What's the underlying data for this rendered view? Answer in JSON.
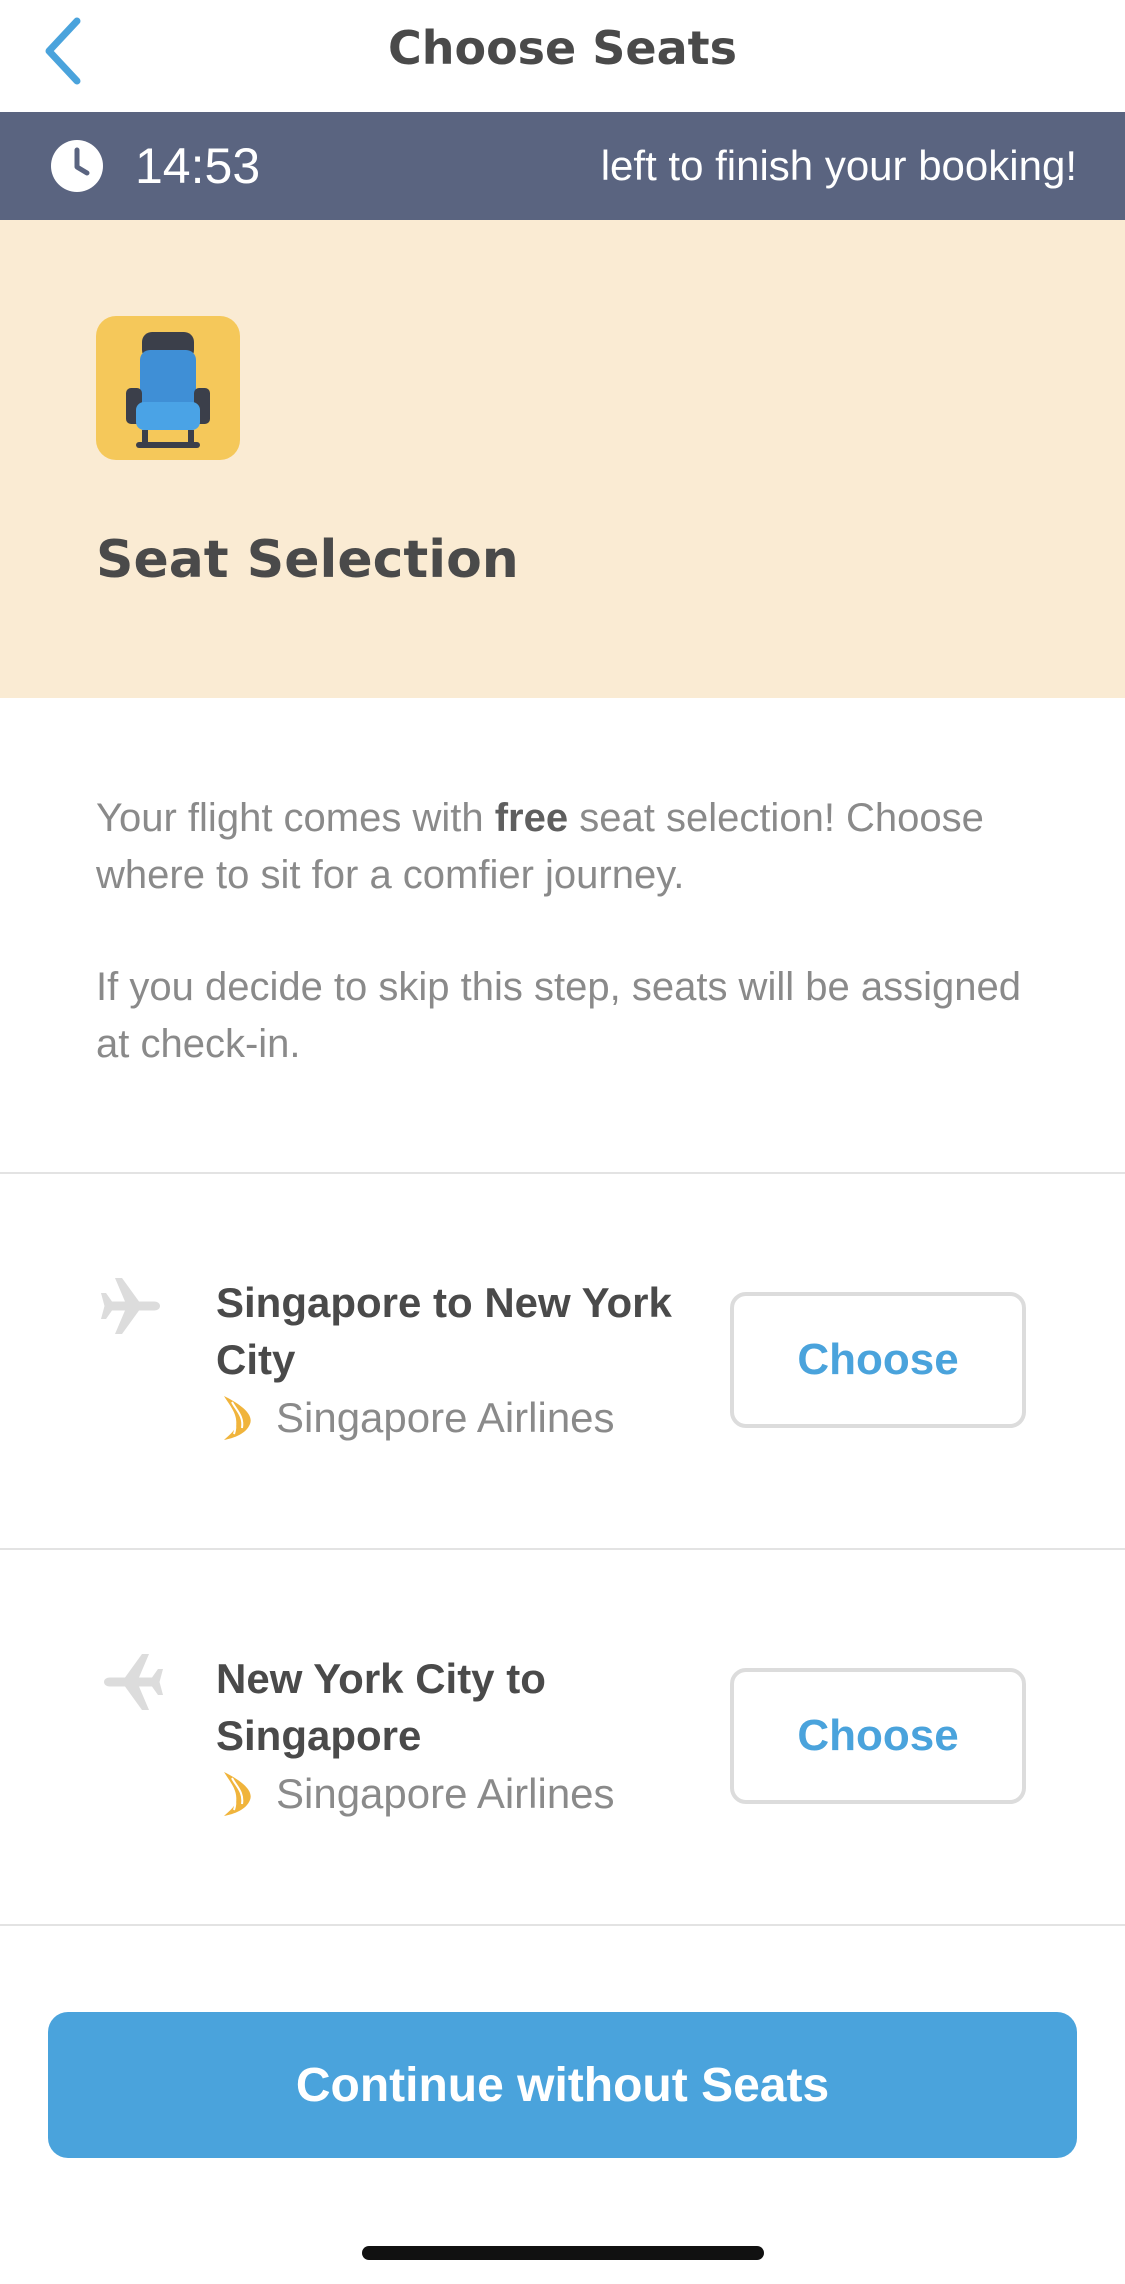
{
  "header": {
    "title": "Choose Seats",
    "back_icon": "chevron-left-icon",
    "accent_color": "#4aa3dc"
  },
  "timer": {
    "time": "14:53",
    "message": "left to finish your booking!",
    "background": "#5a6480"
  },
  "banner": {
    "title": "Seat Selection",
    "icon": "seat-icon",
    "background": "#faebd3"
  },
  "description": {
    "line1_before": "Your flight comes with ",
    "line1_bold": "free",
    "line1_after": " seat selection! Choose where to sit for a comfier journey.",
    "line2": "If you decide to skip this step, seats will be assigned at check-in."
  },
  "flights": [
    {
      "route": "Singapore to New York City",
      "airline": "Singapore Airlines",
      "button_label": "Choose"
    },
    {
      "route": "New York City to Singapore",
      "airline": "Singapore Airlines",
      "button_label": "Choose"
    }
  ],
  "footer": {
    "continue_label": "Continue without Seats"
  }
}
